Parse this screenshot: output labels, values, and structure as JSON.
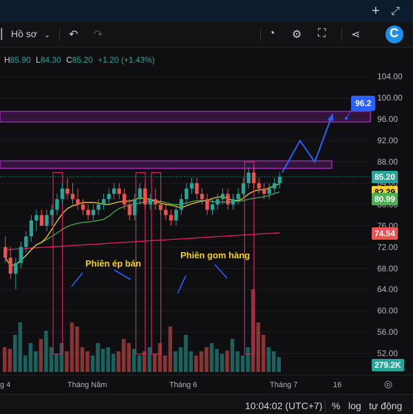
{
  "window": {
    "add_icon": "plus-icon",
    "expand_icon": "expand-icon"
  },
  "toolbar": {
    "layout_label": "Hồ sơ",
    "undo_icon": "undo-icon",
    "redo_icon": "redo-icon",
    "compass_icon": "compass-icon",
    "settings_icon": "gear-icon",
    "fullscreen_icon": "fullscreen-icon",
    "share_icon": "share-icon",
    "logo_letter": "C"
  },
  "ohlc": {
    "h_label": "H",
    "h": "85.90",
    "l_label": "L",
    "l": "84.30",
    "c_label": "C",
    "c": "85.20",
    "change": "+1.20 (+1.43%)"
  },
  "annotations": {
    "press": "Phiên ép bán",
    "accumulate": "Phiên gom hàng"
  },
  "colors": {
    "up": "#26a69a",
    "down": "#ef5350",
    "ma_green": "#4caf50",
    "ma_yellow": "#f5d020",
    "ma_red": "#e91e63",
    "zone": "#9c27b0",
    "arrow": "#2962ff"
  },
  "chart_data": {
    "type": "candlestick",
    "y_ticks": [
      "104.00",
      "100.00",
      "96.00",
      "92.00",
      "88.00",
      "84.00",
      "80.00",
      "76.00",
      "72.00",
      "68.00",
      "64.00",
      "60.00",
      "56.00",
      "52.00"
    ],
    "ylim": [
      48,
      106
    ],
    "badges": [
      {
        "value": "96.2",
        "color": "#2962ff",
        "text": "#ffffff"
      },
      {
        "value": "85.20",
        "color": "#26a69a",
        "text": "#ffffff"
      },
      {
        "value": "82.29",
        "color": "#f5d020",
        "text": "#000000"
      },
      {
        "value": "80.99",
        "color": "#4caf50",
        "text": "#ffffff"
      },
      {
        "value": "74.54",
        "color": "#ef5350",
        "text": "#ffffff"
      },
      {
        "value": "279.2K",
        "color": "#26a69a",
        "text": "#ffffff"
      }
    ],
    "x_ticks": [
      "g 4",
      "Tháng Năm",
      "Tháng 6",
      "Tháng 7",
      "16"
    ],
    "resistance_zones": [
      [
        95.5,
        97.5
      ],
      [
        86.8,
        88.2
      ]
    ],
    "forecast_path": [
      [
        0,
        86
      ],
      [
        6,
        92
      ],
      [
        11,
        88
      ],
      [
        17,
        97
      ]
    ],
    "candles": [
      [
        72,
        74,
        69,
        70
      ],
      [
        70,
        72,
        66,
        67
      ],
      [
        67,
        70,
        64,
        69
      ],
      [
        69,
        73,
        68,
        72
      ],
      [
        72,
        75,
        71,
        74
      ],
      [
        74,
        78,
        73,
        77
      ],
      [
        77,
        79,
        75,
        78
      ],
      [
        78,
        79,
        76,
        76
      ],
      [
        76,
        79,
        75,
        78
      ],
      [
        78,
        80,
        76,
        79
      ],
      [
        79,
        82,
        78,
        81
      ],
      [
        81,
        84,
        80,
        83
      ],
      [
        83,
        85,
        81,
        82
      ],
      [
        82,
        84,
        80,
        81
      ],
      [
        81,
        83,
        79,
        80
      ],
      [
        80,
        81,
        78,
        79
      ],
      [
        79,
        80,
        77,
        78
      ],
      [
        78,
        80,
        77,
        79
      ],
      [
        79,
        81,
        78,
        80
      ],
      [
        80,
        82,
        79,
        81
      ],
      [
        81,
        83,
        80,
        82
      ],
      [
        82,
        84,
        81,
        83
      ],
      [
        83,
        84,
        81,
        82
      ],
      [
        82,
        83,
        79,
        80
      ],
      [
        80,
        81,
        77,
        78
      ],
      [
        78,
        82,
        77,
        81
      ],
      [
        81,
        84,
        80,
        83
      ],
      [
        83,
        84,
        79,
        80
      ],
      [
        80,
        82,
        79,
        81
      ],
      [
        81,
        83,
        79,
        80
      ],
      [
        80,
        81,
        78,
        79
      ],
      [
        79,
        80,
        77,
        78
      ],
      [
        78,
        79,
        76,
        77
      ],
      [
        77,
        80,
        76,
        79
      ],
      [
        79,
        82,
        78,
        81
      ],
      [
        81,
        84,
        80,
        83
      ],
      [
        83,
        85,
        82,
        84
      ],
      [
        84,
        85,
        81,
        82
      ],
      [
        82,
        83,
        80,
        81
      ],
      [
        81,
        82,
        78,
        79
      ],
      [
        79,
        81,
        78,
        80
      ],
      [
        80,
        82,
        79,
        81
      ],
      [
        81,
        83,
        80,
        82
      ],
      [
        82,
        83,
        79,
        80
      ],
      [
        80,
        82,
        79,
        81
      ],
      [
        81,
        83,
        80,
        82
      ],
      [
        82,
        85,
        81,
        84
      ],
      [
        84,
        87,
        83,
        86
      ],
      [
        86,
        87,
        83,
        84
      ],
      [
        84,
        85,
        82,
        83
      ],
      [
        83,
        84,
        81,
        82
      ],
      [
        82,
        84,
        81,
        83
      ],
      [
        83,
        85,
        82,
        84
      ],
      [
        84,
        86,
        83,
        85.2
      ]
    ],
    "volumes": [
      30,
      28,
      45,
      60,
      20,
      35,
      25,
      40,
      50,
      30,
      22,
      35,
      25,
      60,
      55,
      30,
      25,
      20,
      35,
      28,
      30,
      22,
      25,
      40,
      35,
      28,
      20,
      25,
      30,
      22,
      35,
      20,
      55,
      25,
      30,
      45,
      25,
      20,
      25,
      30,
      35,
      28,
      22,
      26,
      40,
      25,
      20,
      30,
      100,
      60,
      45,
      30,
      25,
      18
    ]
  }
}
